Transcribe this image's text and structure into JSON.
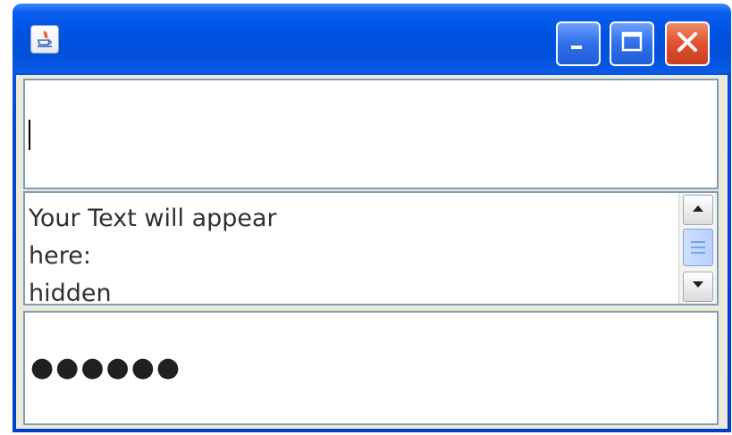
{
  "window": {
    "title": "",
    "icons": {
      "app": "java-coffee-cup-icon",
      "minimize": "minimize-icon",
      "maximize": "maximize-icon",
      "close": "close-icon"
    },
    "colors": {
      "titlebar": "#0054e4",
      "close_button": "#e0502f",
      "field_border": "#7f9db9",
      "scroll_thumb": "#b8d0ff"
    }
  },
  "text_input": {
    "value": "",
    "has_focus": true
  },
  "output_area": {
    "text": "Your Text will appear\nhere:\nhidden",
    "scroll_icons": {
      "up": "arrow-up-icon",
      "down": "arrow-down-icon",
      "thumb": "scroll-thumb-grip-icon"
    }
  },
  "password_field": {
    "masked_value": "●●●●●●"
  }
}
